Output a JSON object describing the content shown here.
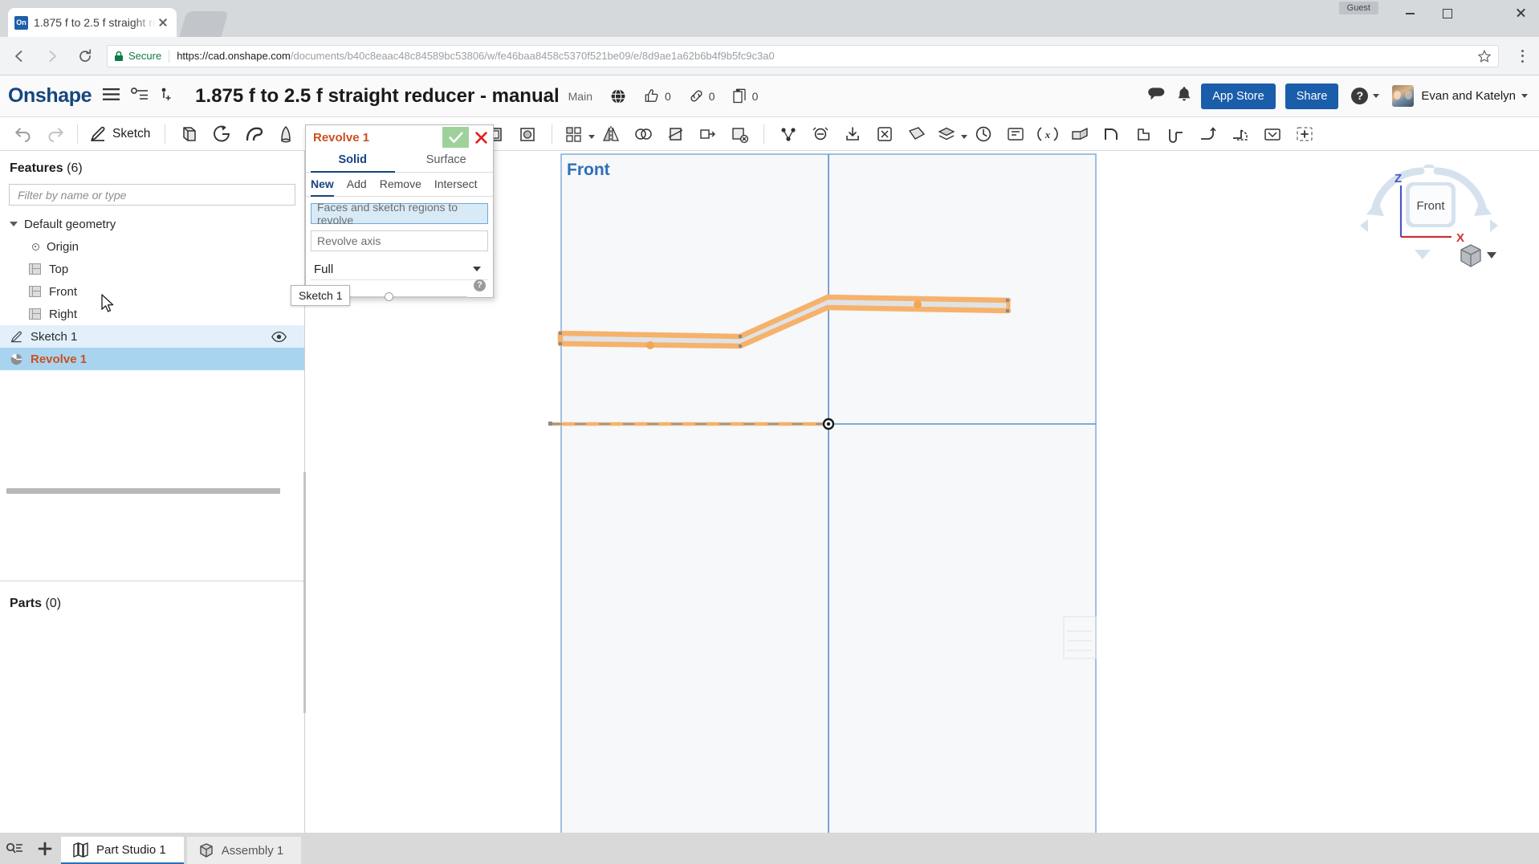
{
  "browser": {
    "tab": {
      "title": "1.875 f to 2.5 f straight re",
      "favicon_text": "On"
    },
    "guest_label": "Guest",
    "security_label": "Secure",
    "url_scheme": "https://",
    "url_host": "cad.onshape.com",
    "url_path": "/documents/b40c8eaac48c84589bc53806/w/fe46baa8458c5370f521be09/e/8d9ae1a62b6b4f9b5fc9c3a0"
  },
  "header": {
    "logo": "Onshape",
    "document_title": "1.875 f to 2.5 f straight reducer - manual",
    "branch": "Main",
    "likes_count": "0",
    "links_count": "0",
    "copies_count": "0",
    "app_store_label": "App Store",
    "share_label": "Share",
    "user_name": "Evan and Katelyn",
    "help_label": "?",
    "accent_blue": "#1a5dab"
  },
  "toolbar": {
    "sketch_label": "Sketch"
  },
  "features_panel": {
    "title": "Features",
    "count": "(6)",
    "filter_placeholder": "Filter by name or type",
    "default_geometry_label": "Default geometry",
    "items": [
      {
        "label": "Origin",
        "icon": "origin-icon"
      },
      {
        "label": "Top",
        "icon": "plane-icon"
      },
      {
        "label": "Front",
        "icon": "plane-icon"
      },
      {
        "label": "Right",
        "icon": "plane-icon"
      }
    ],
    "sketch_feature": "Sketch 1",
    "revolve_feature": "Revolve 1",
    "parts_title": "Parts",
    "parts_count": "(0)"
  },
  "tooltip": {
    "text": "Sketch 1"
  },
  "dialog": {
    "title": "Revolve 1",
    "type_tabs": [
      {
        "label": "Solid",
        "active": true
      },
      {
        "label": "Surface",
        "active": false
      }
    ],
    "operation_tabs": [
      {
        "label": "New",
        "active": true
      },
      {
        "label": "Add",
        "active": false
      },
      {
        "label": "Remove",
        "active": false
      },
      {
        "label": "Intersect",
        "active": false
      }
    ],
    "faces_field_placeholder": "Faces and sketch regions to revolve",
    "axis_field_placeholder": "Revolve axis",
    "extent_value": "Full",
    "help_label": "?",
    "title_color": "#cc4f20",
    "active_color": "#16457e"
  },
  "viewport": {
    "plane_label": "Front",
    "sketch_color": "#f6b26b",
    "plane_border_color": "#8ab0d9",
    "region_fill": "#dfe3e8"
  },
  "viewcube": {
    "face_label": "Front",
    "axis_z": "Z",
    "axis_x": "X",
    "z_color": "#4a55c8",
    "x_color": "#cc3333"
  },
  "bottom_bar": {
    "tabs": [
      {
        "label": "Part Studio 1",
        "active": true
      },
      {
        "label": "Assembly 1",
        "active": false
      }
    ]
  }
}
